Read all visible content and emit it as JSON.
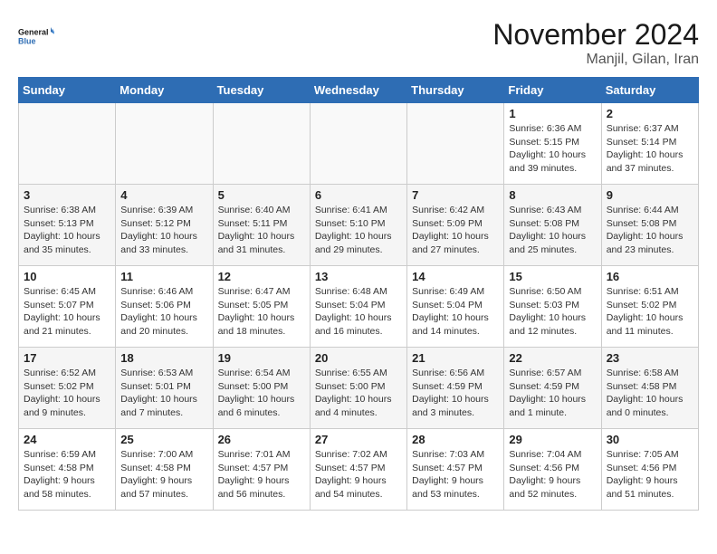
{
  "logo": {
    "line1": "General",
    "line2": "Blue"
  },
  "title": "November 2024",
  "location": "Manjil, Gilan, Iran",
  "days_of_week": [
    "Sunday",
    "Monday",
    "Tuesday",
    "Wednesday",
    "Thursday",
    "Friday",
    "Saturday"
  ],
  "weeks": [
    [
      {
        "day": "",
        "info": ""
      },
      {
        "day": "",
        "info": ""
      },
      {
        "day": "",
        "info": ""
      },
      {
        "day": "",
        "info": ""
      },
      {
        "day": "",
        "info": ""
      },
      {
        "day": "1",
        "info": "Sunrise: 6:36 AM\nSunset: 5:15 PM\nDaylight: 10 hours and 39 minutes."
      },
      {
        "day": "2",
        "info": "Sunrise: 6:37 AM\nSunset: 5:14 PM\nDaylight: 10 hours and 37 minutes."
      }
    ],
    [
      {
        "day": "3",
        "info": "Sunrise: 6:38 AM\nSunset: 5:13 PM\nDaylight: 10 hours and 35 minutes."
      },
      {
        "day": "4",
        "info": "Sunrise: 6:39 AM\nSunset: 5:12 PM\nDaylight: 10 hours and 33 minutes."
      },
      {
        "day": "5",
        "info": "Sunrise: 6:40 AM\nSunset: 5:11 PM\nDaylight: 10 hours and 31 minutes."
      },
      {
        "day": "6",
        "info": "Sunrise: 6:41 AM\nSunset: 5:10 PM\nDaylight: 10 hours and 29 minutes."
      },
      {
        "day": "7",
        "info": "Sunrise: 6:42 AM\nSunset: 5:09 PM\nDaylight: 10 hours and 27 minutes."
      },
      {
        "day": "8",
        "info": "Sunrise: 6:43 AM\nSunset: 5:08 PM\nDaylight: 10 hours and 25 minutes."
      },
      {
        "day": "9",
        "info": "Sunrise: 6:44 AM\nSunset: 5:08 PM\nDaylight: 10 hours and 23 minutes."
      }
    ],
    [
      {
        "day": "10",
        "info": "Sunrise: 6:45 AM\nSunset: 5:07 PM\nDaylight: 10 hours and 21 minutes."
      },
      {
        "day": "11",
        "info": "Sunrise: 6:46 AM\nSunset: 5:06 PM\nDaylight: 10 hours and 20 minutes."
      },
      {
        "day": "12",
        "info": "Sunrise: 6:47 AM\nSunset: 5:05 PM\nDaylight: 10 hours and 18 minutes."
      },
      {
        "day": "13",
        "info": "Sunrise: 6:48 AM\nSunset: 5:04 PM\nDaylight: 10 hours and 16 minutes."
      },
      {
        "day": "14",
        "info": "Sunrise: 6:49 AM\nSunset: 5:04 PM\nDaylight: 10 hours and 14 minutes."
      },
      {
        "day": "15",
        "info": "Sunrise: 6:50 AM\nSunset: 5:03 PM\nDaylight: 10 hours and 12 minutes."
      },
      {
        "day": "16",
        "info": "Sunrise: 6:51 AM\nSunset: 5:02 PM\nDaylight: 10 hours and 11 minutes."
      }
    ],
    [
      {
        "day": "17",
        "info": "Sunrise: 6:52 AM\nSunset: 5:02 PM\nDaylight: 10 hours and 9 minutes."
      },
      {
        "day": "18",
        "info": "Sunrise: 6:53 AM\nSunset: 5:01 PM\nDaylight: 10 hours and 7 minutes."
      },
      {
        "day": "19",
        "info": "Sunrise: 6:54 AM\nSunset: 5:00 PM\nDaylight: 10 hours and 6 minutes."
      },
      {
        "day": "20",
        "info": "Sunrise: 6:55 AM\nSunset: 5:00 PM\nDaylight: 10 hours and 4 minutes."
      },
      {
        "day": "21",
        "info": "Sunrise: 6:56 AM\nSunset: 4:59 PM\nDaylight: 10 hours and 3 minutes."
      },
      {
        "day": "22",
        "info": "Sunrise: 6:57 AM\nSunset: 4:59 PM\nDaylight: 10 hours and 1 minute."
      },
      {
        "day": "23",
        "info": "Sunrise: 6:58 AM\nSunset: 4:58 PM\nDaylight: 10 hours and 0 minutes."
      }
    ],
    [
      {
        "day": "24",
        "info": "Sunrise: 6:59 AM\nSunset: 4:58 PM\nDaylight: 9 hours and 58 minutes."
      },
      {
        "day": "25",
        "info": "Sunrise: 7:00 AM\nSunset: 4:58 PM\nDaylight: 9 hours and 57 minutes."
      },
      {
        "day": "26",
        "info": "Sunrise: 7:01 AM\nSunset: 4:57 PM\nDaylight: 9 hours and 56 minutes."
      },
      {
        "day": "27",
        "info": "Sunrise: 7:02 AM\nSunset: 4:57 PM\nDaylight: 9 hours and 54 minutes."
      },
      {
        "day": "28",
        "info": "Sunrise: 7:03 AM\nSunset: 4:57 PM\nDaylight: 9 hours and 53 minutes."
      },
      {
        "day": "29",
        "info": "Sunrise: 7:04 AM\nSunset: 4:56 PM\nDaylight: 9 hours and 52 minutes."
      },
      {
        "day": "30",
        "info": "Sunrise: 7:05 AM\nSunset: 4:56 PM\nDaylight: 9 hours and 51 minutes."
      }
    ]
  ]
}
